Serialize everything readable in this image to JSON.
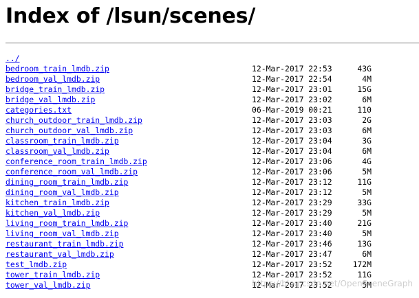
{
  "page": {
    "title": "Index of /lsun/scenes/"
  },
  "parent_link": "../",
  "files": [
    {
      "name": "bedroom_train_lmdb.zip",
      "date": "12-Mar-2017 22:53",
      "size": "43G"
    },
    {
      "name": "bedroom_val_lmdb.zip",
      "date": "12-Mar-2017 22:54",
      "size": "4M"
    },
    {
      "name": "bridge_train_lmdb.zip",
      "date": "12-Mar-2017 23:01",
      "size": "15G"
    },
    {
      "name": "bridge_val_lmdb.zip",
      "date": "12-Mar-2017 23:02",
      "size": "6M"
    },
    {
      "name": "categories.txt",
      "date": "06-Mar-2019 00:21",
      "size": "110"
    },
    {
      "name": "church_outdoor_train_lmdb.zip",
      "date": "12-Mar-2017 23:03",
      "size": "2G"
    },
    {
      "name": "church_outdoor_val_lmdb.zip",
      "date": "12-Mar-2017 23:03",
      "size": "6M"
    },
    {
      "name": "classroom_train_lmdb.zip",
      "date": "12-Mar-2017 23:04",
      "size": "3G"
    },
    {
      "name": "classroom_val_lmdb.zip",
      "date": "12-Mar-2017 23:04",
      "size": "6M"
    },
    {
      "name": "conference_room_train_lmdb.zip",
      "date": "12-Mar-2017 23:06",
      "size": "4G"
    },
    {
      "name": "conference_room_val_lmdb.zip",
      "date": "12-Mar-2017 23:06",
      "size": "5M"
    },
    {
      "name": "dining_room_train_lmdb.zip",
      "date": "12-Mar-2017 23:12",
      "size": "11G"
    },
    {
      "name": "dining_room_val_lmdb.zip",
      "date": "12-Mar-2017 23:12",
      "size": "5M"
    },
    {
      "name": "kitchen_train_lmdb.zip",
      "date": "12-Mar-2017 23:29",
      "size": "33G"
    },
    {
      "name": "kitchen_val_lmdb.zip",
      "date": "12-Mar-2017 23:29",
      "size": "5M"
    },
    {
      "name": "living_room_train_lmdb.zip",
      "date": "12-Mar-2017 23:40",
      "size": "21G"
    },
    {
      "name": "living_room_val_lmdb.zip",
      "date": "12-Mar-2017 23:40",
      "size": "5M"
    },
    {
      "name": "restaurant_train_lmdb.zip",
      "date": "12-Mar-2017 23:46",
      "size": "13G"
    },
    {
      "name": "restaurant_val_lmdb.zip",
      "date": "12-Mar-2017 23:47",
      "size": "6M"
    },
    {
      "name": "test_lmdb.zip",
      "date": "12-Mar-2017 23:52",
      "size": "172M"
    },
    {
      "name": "tower_train_lmdb.zip",
      "date": "12-Mar-2017 23:52",
      "size": "11G"
    },
    {
      "name": "tower_val_lmdb.zip",
      "date": "12-Mar-2017 23:52",
      "size": "5M"
    }
  ],
  "watermark": "https://blog.csdn.net/OpenSceneGraph",
  "colors": {
    "link": "#0000ee",
    "text": "#000000",
    "background": "#ffffff"
  }
}
